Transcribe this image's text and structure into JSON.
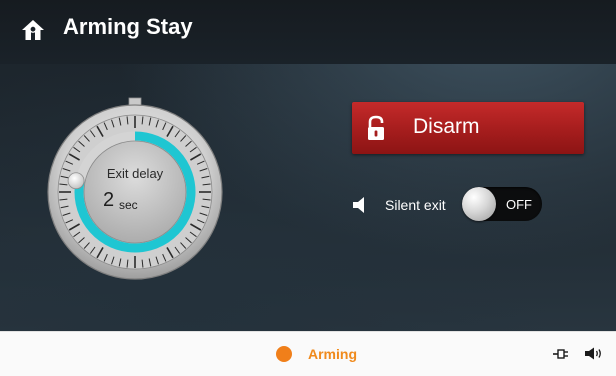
{
  "header": {
    "title": "Arming Stay",
    "icon": "home-shield-icon"
  },
  "dial": {
    "label": "Exit delay",
    "value": "2",
    "unit": "sec",
    "accent_color": "#1fc6d2",
    "progress_fraction": 0.78
  },
  "actions": {
    "disarm_label": "Disarm",
    "disarm_icon": "unlocked-padlock-icon",
    "disarm_color": "#b02020"
  },
  "silent_exit": {
    "label": "Silent exit",
    "icon": "speaker-icon",
    "toggle_state": "OFF"
  },
  "status_bar": {
    "status_text": "Arming",
    "status_color": "#f07f1a",
    "icons": [
      "power-plug-icon",
      "volume-icon"
    ]
  }
}
